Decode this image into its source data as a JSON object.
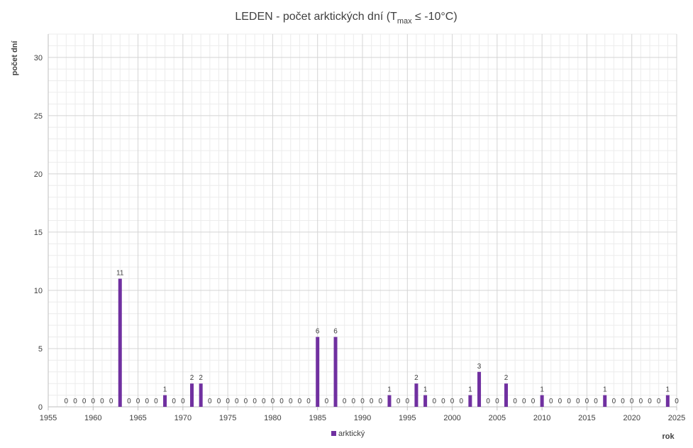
{
  "chart_data": {
    "type": "bar",
    "title": {
      "main": "LEDEN - počet arktických dní (T",
      "sub": "max",
      "tail": " ≤ -10°C)"
    },
    "xlabel": "rok",
    "ylabel": "počet dní",
    "xlim": [
      1955,
      2025
    ],
    "ylim": [
      0,
      32
    ],
    "x_ticks": [
      1955,
      1960,
      1965,
      1970,
      1975,
      1980,
      1985,
      1990,
      1995,
      2000,
      2005,
      2010,
      2015,
      2020,
      2025
    ],
    "y_ticks": [
      0,
      5,
      10,
      15,
      20,
      25,
      30
    ],
    "grid": true,
    "legend_position": "bottom",
    "series": [
      {
        "name": "arktický",
        "color": "#7030a0",
        "points": [
          {
            "x": 1957,
            "y": 0
          },
          {
            "x": 1958,
            "y": 0
          },
          {
            "x": 1959,
            "y": 0
          },
          {
            "x": 1960,
            "y": 0
          },
          {
            "x": 1961,
            "y": 0
          },
          {
            "x": 1962,
            "y": 0
          },
          {
            "x": 1963,
            "y": 11
          },
          {
            "x": 1964,
            "y": 0
          },
          {
            "x": 1965,
            "y": 0
          },
          {
            "x": 1966,
            "y": 0
          },
          {
            "x": 1967,
            "y": 0
          },
          {
            "x": 1968,
            "y": 1
          },
          {
            "x": 1969,
            "y": 0
          },
          {
            "x": 1970,
            "y": 0
          },
          {
            "x": 1971,
            "y": 2
          },
          {
            "x": 1972,
            "y": 2
          },
          {
            "x": 1973,
            "y": 0
          },
          {
            "x": 1974,
            "y": 0
          },
          {
            "x": 1975,
            "y": 0
          },
          {
            "x": 1976,
            "y": 0
          },
          {
            "x": 1977,
            "y": 0
          },
          {
            "x": 1978,
            "y": 0
          },
          {
            "x": 1979,
            "y": 0
          },
          {
            "x": 1980,
            "y": 0
          },
          {
            "x": 1981,
            "y": 0
          },
          {
            "x": 1982,
            "y": 0
          },
          {
            "x": 1983,
            "y": 0
          },
          {
            "x": 1984,
            "y": 0
          },
          {
            "x": 1985,
            "y": 6
          },
          {
            "x": 1986,
            "y": 0
          },
          {
            "x": 1987,
            "y": 6
          },
          {
            "x": 1988,
            "y": 0
          },
          {
            "x": 1989,
            "y": 0
          },
          {
            "x": 1990,
            "y": 0
          },
          {
            "x": 1991,
            "y": 0
          },
          {
            "x": 1992,
            "y": 0
          },
          {
            "x": 1993,
            "y": 1
          },
          {
            "x": 1994,
            "y": 0
          },
          {
            "x": 1995,
            "y": 0
          },
          {
            "x": 1996,
            "y": 2
          },
          {
            "x": 1997,
            "y": 1
          },
          {
            "x": 1998,
            "y": 0
          },
          {
            "x": 1999,
            "y": 0
          },
          {
            "x": 2000,
            "y": 0
          },
          {
            "x": 2001,
            "y": 0
          },
          {
            "x": 2002,
            "y": 1
          },
          {
            "x": 2003,
            "y": 3
          },
          {
            "x": 2004,
            "y": 0
          },
          {
            "x": 2005,
            "y": 0
          },
          {
            "x": 2006,
            "y": 2
          },
          {
            "x": 2007,
            "y": 0
          },
          {
            "x": 2008,
            "y": 0
          },
          {
            "x": 2009,
            "y": 0
          },
          {
            "x": 2010,
            "y": 1
          },
          {
            "x": 2011,
            "y": 0
          },
          {
            "x": 2012,
            "y": 0
          },
          {
            "x": 2013,
            "y": 0
          },
          {
            "x": 2014,
            "y": 0
          },
          {
            "x": 2015,
            "y": 0
          },
          {
            "x": 2016,
            "y": 0
          },
          {
            "x": 2017,
            "y": 1
          },
          {
            "x": 2018,
            "y": 0
          },
          {
            "x": 2019,
            "y": 0
          },
          {
            "x": 2020,
            "y": 0
          },
          {
            "x": 2021,
            "y": 0
          },
          {
            "x": 2022,
            "y": 0
          },
          {
            "x": 2023,
            "y": 0
          },
          {
            "x": 2024,
            "y": 1
          },
          {
            "x": 2025,
            "y": 0
          }
        ]
      }
    ]
  }
}
